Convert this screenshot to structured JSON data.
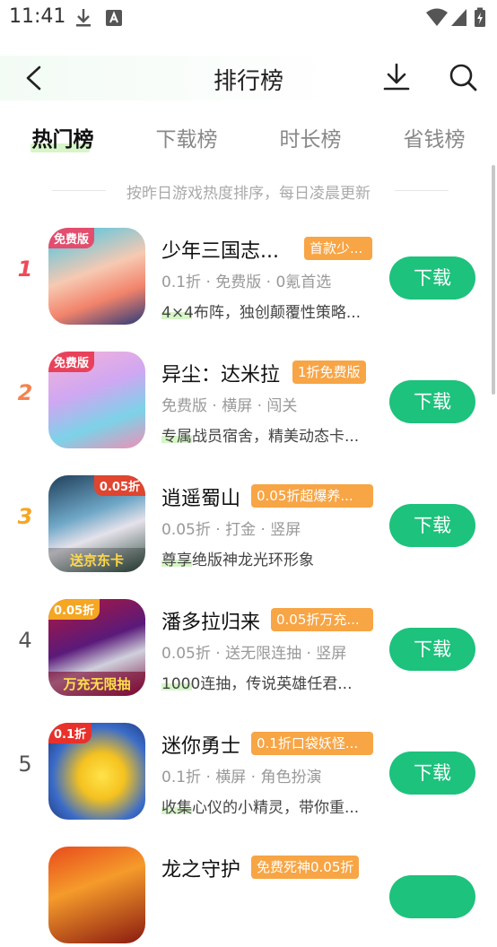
{
  "status": {
    "time": "11:41"
  },
  "header": {
    "title": "排行榜"
  },
  "tabs": [
    {
      "label": "热门榜"
    },
    {
      "label": "下载榜"
    },
    {
      "label": "时长榜"
    },
    {
      "label": "省钱榜"
    }
  ],
  "subtitle": "按昨日游戏热度排序，每日凌晨更新",
  "games": [
    {
      "rank": "1",
      "name": "少年三国志...",
      "tag": "首款少...",
      "meta": "0.1折 · 免费版 · 0氪首选",
      "desc": "4×4布阵，独创颠覆性策略...",
      "button": "下载",
      "icon_badge": "免费版",
      "icon_foot": ""
    },
    {
      "rank": "2",
      "name": "异尘：达米拉",
      "tag": "1折免费版",
      "meta": "免费版 · 横屏 · 闯关",
      "desc": "专属战员宿舍，精美动态卡...",
      "button": "下载",
      "icon_badge": "免费版",
      "icon_foot": ""
    },
    {
      "rank": "3",
      "name": "逍遥蜀山",
      "tag": "0.05折超爆养...",
      "meta": "0.05折 · 打金 · 竖屏",
      "desc": "尊享绝版神龙光环形象",
      "button": "下载",
      "icon_badge": "0.05折",
      "icon_foot": "送京东卡"
    },
    {
      "rank": "4",
      "name": "潘多拉归来",
      "tag": "0.05折万充...",
      "meta": "0.05折 · 送无限连抽 · 竖屏",
      "desc": "1000连抽，传说英雄任君...",
      "button": "下载",
      "icon_badge": "0.05折",
      "icon_foot": "万充无限抽"
    },
    {
      "rank": "5",
      "name": "迷你勇士",
      "tag": "0.1折口袋妖怪...",
      "meta": "0.1折 · 横屏 · 角色扮演",
      "desc": "收集心仪的小精灵，带你重...",
      "button": "下载",
      "icon_badge": "0.1折",
      "icon_foot": ""
    },
    {
      "rank": "",
      "name": "龙之守护",
      "tag": "免费死神0.05折",
      "meta": "",
      "desc": "",
      "button": "",
      "icon_badge": "",
      "icon_foot": ""
    }
  ],
  "colors": {
    "accent": "#1dc27c",
    "tag": "#f7a545",
    "rank1": "#f04a58",
    "rank2": "#f4824e",
    "rank3": "#f5a623"
  }
}
